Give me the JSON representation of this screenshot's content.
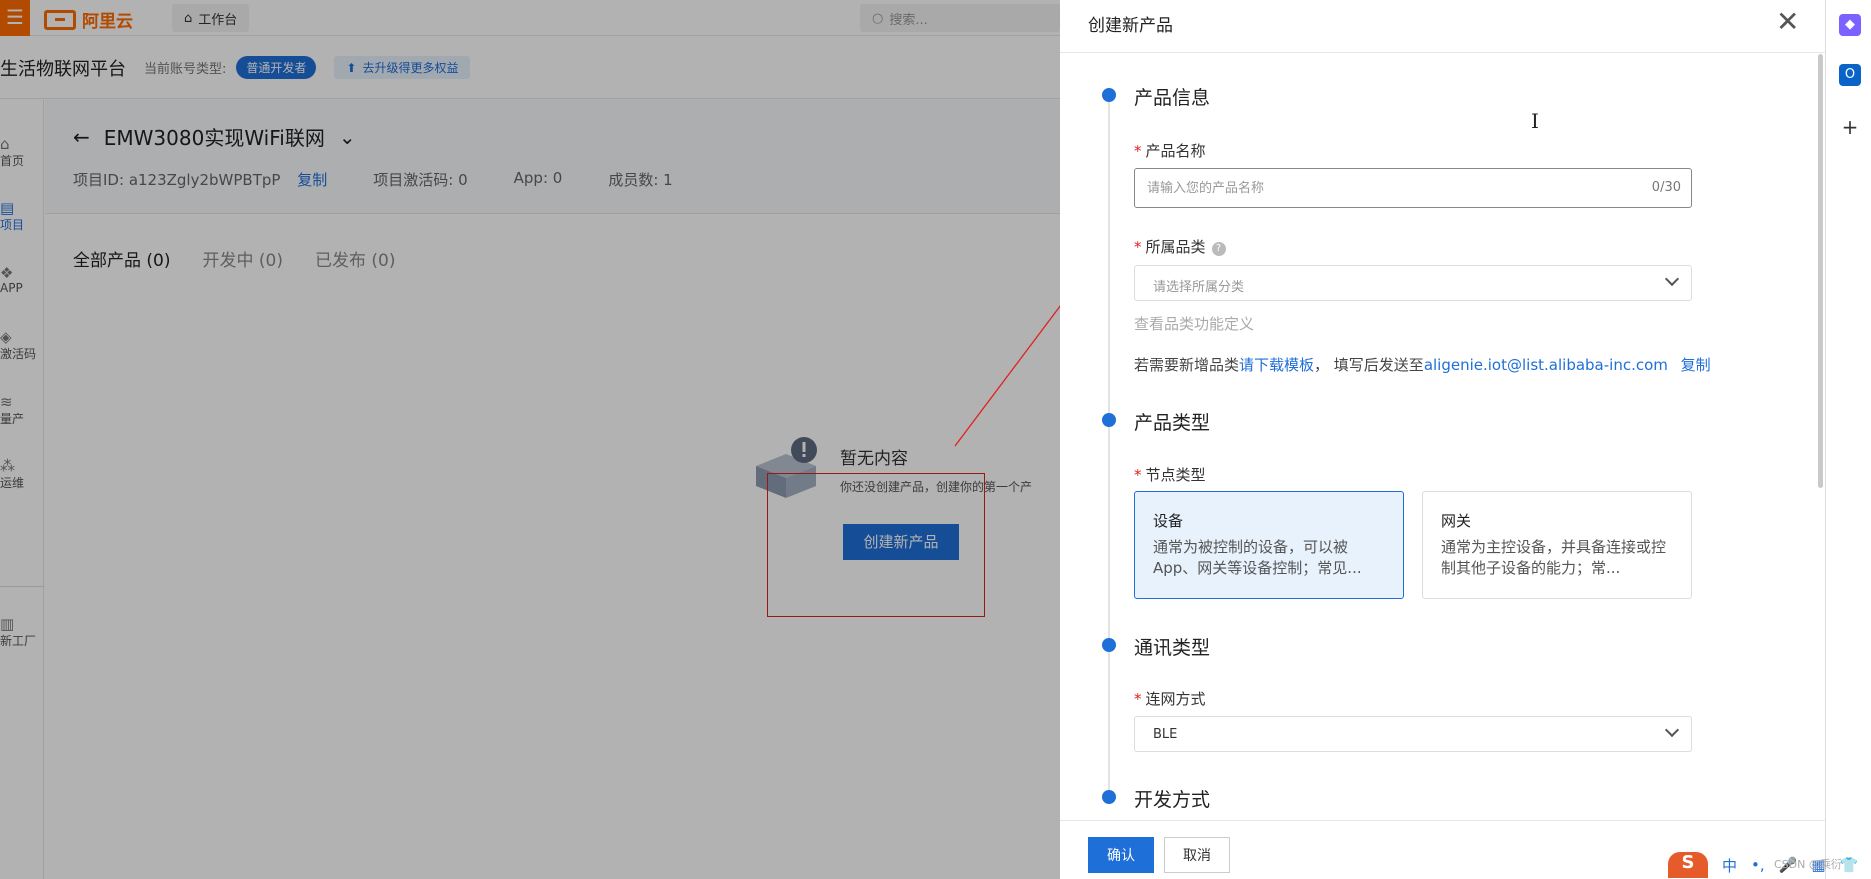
{
  "topbar": {
    "menu_icon": "menu-icon",
    "logo_text": "阿里云",
    "workbench_label": "工作台",
    "search_placeholder": "搜索..."
  },
  "subbar": {
    "platform_title": "生活物联网平台",
    "account_type_label": "当前账号类型:",
    "account_type_badge": "普通开发者",
    "upgrade_label": "去升级得更多权益"
  },
  "leftnav": {
    "items": [
      {
        "label": "首页",
        "icon": "home-icon"
      },
      {
        "label": "项目",
        "icon": "project-icon",
        "active": true
      },
      {
        "label": "APP",
        "icon": "app-icon"
      },
      {
        "label": "激活码",
        "icon": "shield-icon"
      },
      {
        "label": "量产",
        "icon": "layers-icon"
      },
      {
        "label": "运维",
        "icon": "cluster-icon"
      },
      {
        "label": "新工厂",
        "icon": "factory-icon"
      }
    ]
  },
  "project": {
    "title": "EMW3080实现WiFi联网",
    "id_label": "项目ID:",
    "id_value": "a123Zgly2bWPBTpP",
    "copy_label": "复制",
    "activation_label": "项目激活码:",
    "activation_value": "0",
    "app_label": "App:",
    "app_value": "0",
    "members_label": "成员数:",
    "members_value": "1"
  },
  "tabs": [
    {
      "label": "全部产品 (0)",
      "active": true
    },
    {
      "label": "开发中 (0)",
      "active": false
    },
    {
      "label": "已发布 (0)",
      "active": false
    }
  ],
  "empty_state": {
    "title": "暂无内容",
    "desc": "你还没创建产品，创建你的第一个产",
    "button": "创建新产品"
  },
  "drawer": {
    "title": "创建新产品",
    "close_icon": "close-icon",
    "sections": {
      "product_info": "产品信息",
      "product_type": "产品类型",
      "comm_type": "通讯类型",
      "dev_mode": "开发方式"
    },
    "product_name": {
      "label": "产品名称",
      "placeholder": "请输入您的产品名称",
      "value": "",
      "counter": "0/30"
    },
    "category": {
      "label": "所属品类",
      "help_icon": "question-icon",
      "placeholder": "请选择所属分类",
      "view_link": "查看品类功能定义",
      "note_prefix": "若需要新增品类",
      "note_link": "请下载模板",
      "note_mid": "， 填写后发送至",
      "note_email": "aligenie.iot@list.alibaba-inc.com",
      "note_copy": "复制"
    },
    "node_type": {
      "label": "节点类型",
      "options": [
        {
          "title": "设备",
          "desc": "通常为被控制的设备，可以被App、网关等设备控制；常见...",
          "selected": true
        },
        {
          "title": "网关",
          "desc": "通常为主控设备，并具备连接或控制其他子设备的能力；常...",
          "selected": false
        }
      ]
    },
    "network": {
      "label": "连网方式",
      "value": "BLE"
    },
    "footer": {
      "ok": "确认",
      "cancel": "取消"
    }
  },
  "side_strip": {
    "icons": [
      "copilot-icon",
      "outlook-icon",
      "plus-icon"
    ]
  },
  "tray": {
    "ime_label": "中",
    "watermark": "CSDN @乘衍"
  },
  "colors": {
    "primary": "#1f6fd8",
    "brand_orange": "#ff6a00",
    "annotation_red": "#e02020"
  }
}
